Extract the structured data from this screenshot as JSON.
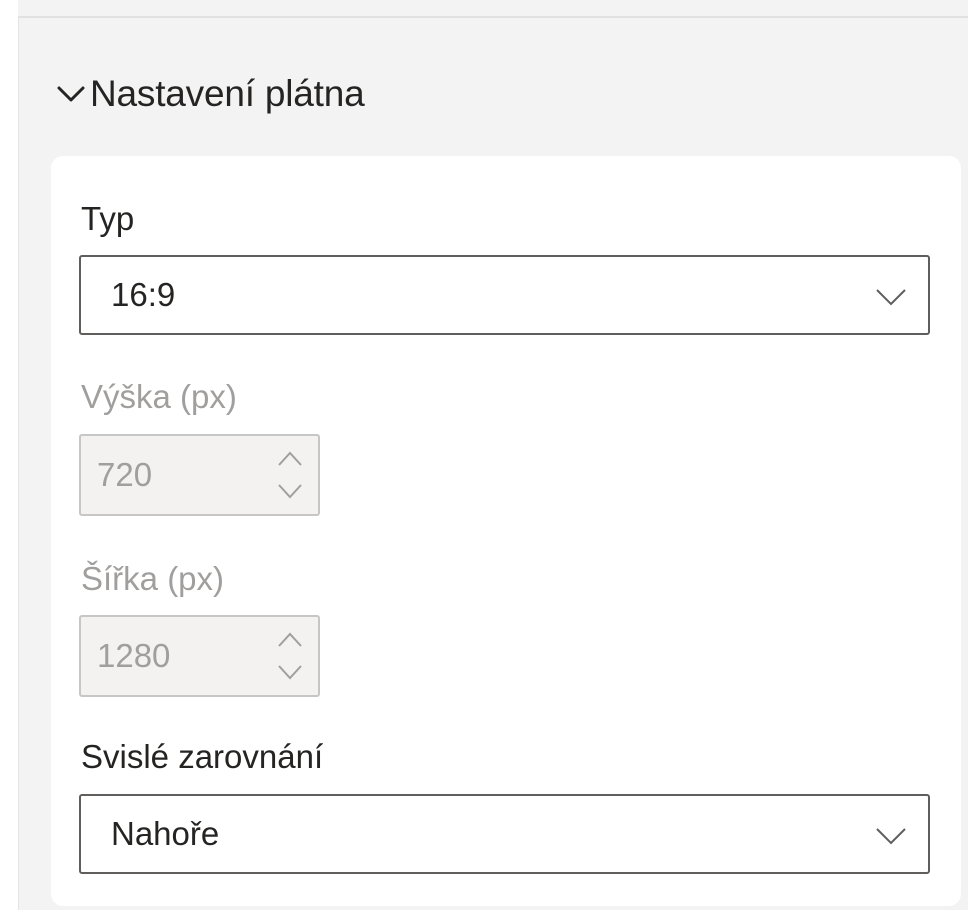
{
  "section": {
    "title": "Nastavení plátna"
  },
  "type_field": {
    "label": "Typ",
    "value": "16:9"
  },
  "height_field": {
    "label": "Výška (px)",
    "value": "720"
  },
  "width_field": {
    "label": "Šířka (px)",
    "value": "1280"
  },
  "alignment_field": {
    "label": "Svislé zarovnání",
    "value": "Nahoře"
  },
  "colors": {
    "text": "#252423",
    "disabled_text": "#a19f9d",
    "panel_bg": "#f3f3f3",
    "card_bg": "#ffffff"
  },
  "icons": {
    "section_toggle": "chevron-down-icon",
    "dropdown": "chevron-down-icon",
    "spinner_up": "chevron-up-icon",
    "spinner_down": "chevron-down-icon"
  }
}
